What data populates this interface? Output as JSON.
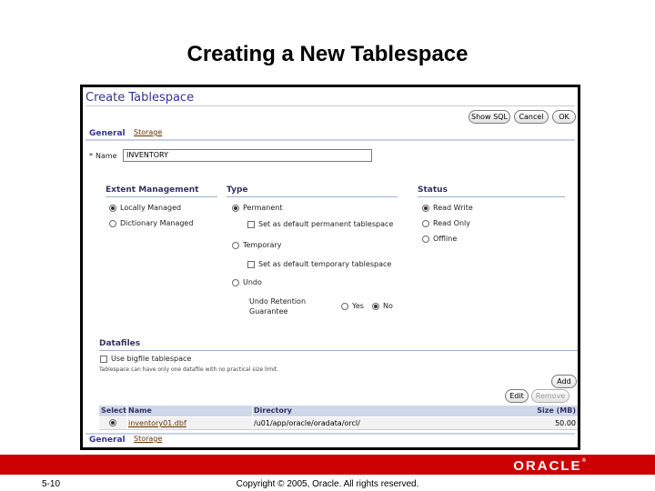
{
  "slide": {
    "title": "Creating a New Tablespace",
    "number": "5-10",
    "copyright": "Copyright © 2005, Oracle. All rights reserved.",
    "logo": "ORACLE",
    "logo_tm": "®"
  },
  "app": {
    "title": "Create Tablespace",
    "buttons": {
      "show_sql": "Show SQL",
      "cancel": "Cancel",
      "ok": "OK"
    },
    "tabs": {
      "general": "General",
      "storage": "Storage"
    },
    "name_field": {
      "required_mark": "*",
      "label": "Name",
      "value": "INVENTORY"
    },
    "extent_management": {
      "header": "Extent Management",
      "options": [
        {
          "label": "Locally Managed",
          "selected": true
        },
        {
          "label": "Dictionary Managed",
          "selected": false
        }
      ]
    },
    "type": {
      "header": "Type",
      "permanent": "Permanent",
      "set_default_permanent": "Set as default permanent tablespace",
      "temporary": "Temporary",
      "set_default_temporary": "Set as default temporary tablespace",
      "undo": "Undo",
      "undo_retention_line1": "Undo Retention",
      "undo_retention_line2": "Guarantee",
      "yes": "Yes",
      "no": "No"
    },
    "status": {
      "header": "Status",
      "options": [
        {
          "label": "Read Write",
          "selected": true
        },
        {
          "label": "Read Only",
          "selected": false
        },
        {
          "label": "Offline",
          "selected": false
        }
      ]
    },
    "datafiles": {
      "header": "Datafiles",
      "bigfile_label": "Use bigfile tablespace",
      "bigfile_note": "Tablespace can have only one datafile with no practical size limit.",
      "add_button": "Add",
      "edit_button": "Edit",
      "remove_button": "Remove",
      "columns": [
        "Select",
        "Name",
        "Directory",
        "Size (MB)"
      ],
      "rows": [
        {
          "name": "inventory01.dbf",
          "directory": "/u01/app/oracle/oradata/orcl/",
          "size": "50.00"
        }
      ]
    }
  }
}
